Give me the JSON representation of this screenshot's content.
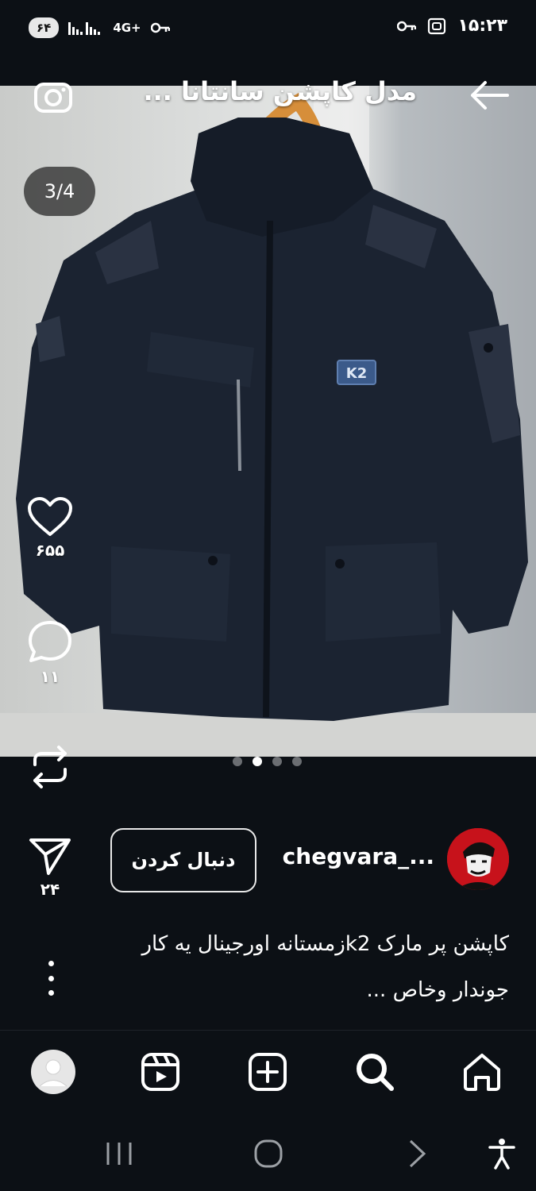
{
  "status_bar": {
    "battery": "۶۴",
    "network": "4G+",
    "time": "۱۵:۲۳"
  },
  "header": {
    "title": "مدل کاپشن سانتانا ...",
    "icons": [
      "back-arrow-icon",
      "camera-icon"
    ]
  },
  "carousel": {
    "counter": "3/4",
    "dot_count": 4,
    "active_index": 1
  },
  "actions": {
    "likes": "۶۵۵",
    "comments": "۱۱",
    "shares": "۲۴"
  },
  "post": {
    "username": "chegvara_...",
    "follow_label": "دنبال کردن",
    "caption_line1": "کاپشن پر مارک k2زمستانه اورجینال یه کار",
    "caption_line2": "جوندار وخاص ..."
  },
  "bottom_nav": {
    "items": [
      "home-icon",
      "search-icon",
      "add-icon",
      "reels-icon",
      "profile-icon"
    ]
  },
  "colors": {
    "background": "#0c1015",
    "jacket": "#1a2230",
    "active_dot": "#ffffff"
  }
}
